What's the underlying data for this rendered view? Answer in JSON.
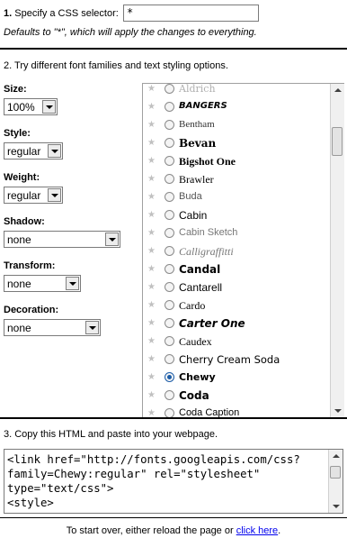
{
  "step1": {
    "number": "1.",
    "label": "Specify a CSS selector:",
    "selector_value": "*",
    "note": "Defaults to \"*\", which will apply the changes to everything."
  },
  "step2": {
    "title": "2. Try different font families and text styling options.",
    "controls": {
      "size": {
        "label": "Size:",
        "value": "100%"
      },
      "style": {
        "label": "Style:",
        "value": "regular"
      },
      "weight": {
        "label": "Weight:",
        "value": "regular"
      },
      "shadow": {
        "label": "Shadow:",
        "value": "none"
      },
      "transform": {
        "label": "Transform:",
        "value": "none"
      },
      "decoration": {
        "label": "Decoration:",
        "value": "none"
      }
    },
    "fonts": [
      "Aldrich",
      "BANGERS",
      "Bentham",
      "Bevan",
      "Bigshot One",
      "Brawler",
      "Buda",
      "Cabin",
      "Cabin Sketch",
      "Calligraffitti",
      "Candal",
      "Cantarell",
      "Cardo",
      "Carter One",
      "Caudex",
      "Cherry Cream Soda",
      "Chewy",
      "Coda",
      "Coda Caption"
    ],
    "selected_font": "Chewy"
  },
  "step3": {
    "title": "3. Copy this HTML and paste into your webpage.",
    "code_lines": [
      "<link href=\"http://fonts.googleapis.com/css?",
      "family=Chewy:regular\" rel=\"stylesheet\"",
      "type=\"text/css\">",
      "<style>"
    ]
  },
  "footer": {
    "text": "To start over, either reload the page or",
    "link": "click here",
    "end": "."
  },
  "icons": {
    "star": "star-icon",
    "radio": "radio-button",
    "dropdown": "chevron-down-icon"
  }
}
